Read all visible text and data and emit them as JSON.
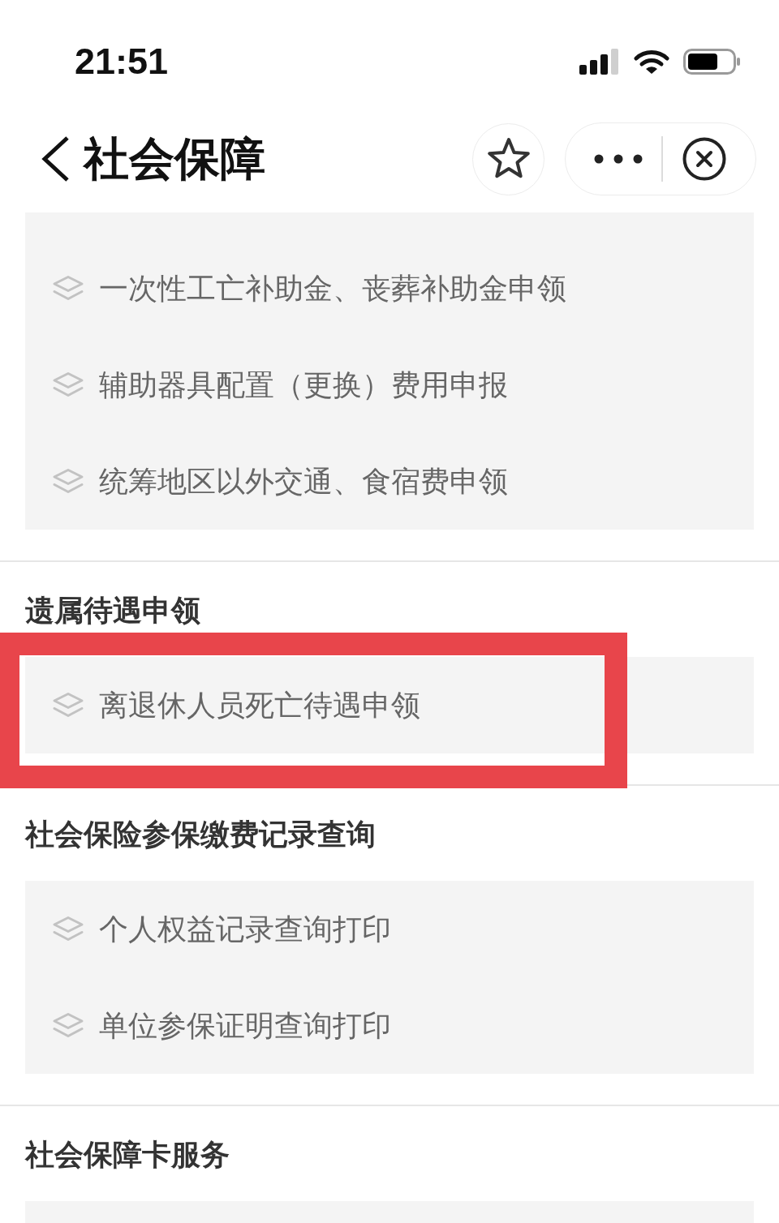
{
  "status_bar": {
    "time": "21:51"
  },
  "nav_bar": {
    "title": "社会保障"
  },
  "sections": [
    {
      "items": [
        {
          "label": "一次性工亡补助金、丧葬补助金申领",
          "highlighted": false
        },
        {
          "label": "辅助器具配置（更换）费用申报",
          "highlighted": false
        },
        {
          "label": "统筹地区以外交通、食宿费申领",
          "highlighted": false
        }
      ]
    },
    {
      "heading": "遗属待遇申领",
      "items": [
        {
          "label": "离退休人员死亡待遇申领",
          "highlighted": true
        }
      ]
    },
    {
      "heading": "社会保险参保缴费记录查询",
      "items": [
        {
          "label": "个人权益记录查询打印",
          "highlighted": false
        },
        {
          "label": "单位参保证明查询打印",
          "highlighted": false
        }
      ]
    },
    {
      "heading": "社会保障卡服务"
    }
  ]
}
